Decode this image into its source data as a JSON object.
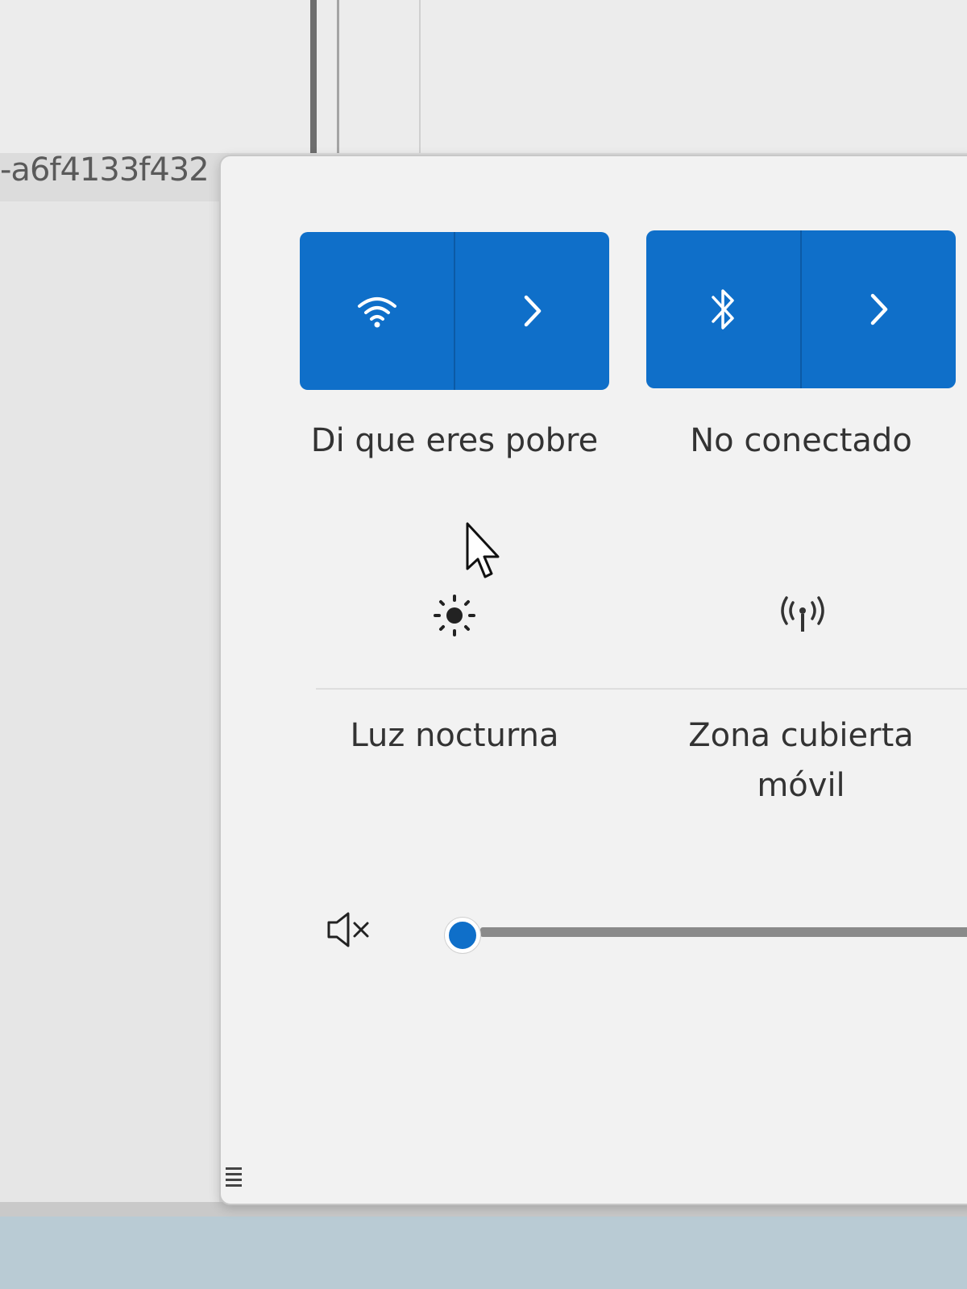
{
  "background": {
    "hash_text": "-a6f4133f432"
  },
  "quick_settings": {
    "tiles": [
      {
        "name": "wifi",
        "label": "Di que eres pobre",
        "icon": "wifi-icon",
        "active": true
      },
      {
        "name": "bluetooth",
        "label": "No conectado",
        "icon": "bluetooth-icon",
        "active": true
      },
      {
        "name": "night-light",
        "label": "Luz nocturna",
        "icon": "brightness-icon",
        "active": false
      },
      {
        "name": "mobile-hotspot",
        "label": "Zona cubierta móvil",
        "icon": "hotspot-icon",
        "active": false
      }
    ],
    "volume": {
      "muted": true,
      "level": 0
    }
  },
  "colors": {
    "accent": "#0f6fc9",
    "panel": "#f2f2f2"
  }
}
